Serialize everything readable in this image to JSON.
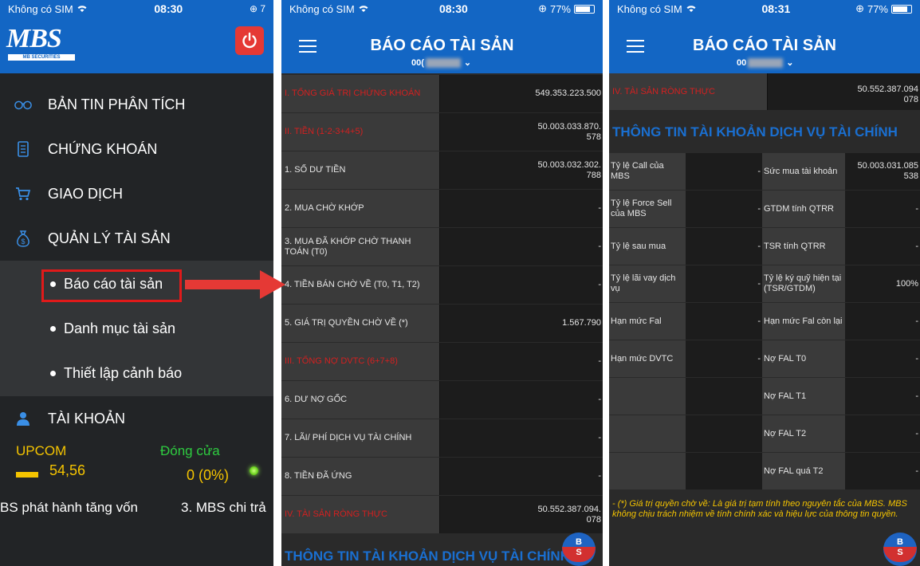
{
  "panel1": {
    "status": {
      "carrier": "Không có SIM",
      "time": "08:30"
    },
    "logo_text": "MBS",
    "logo_sub": "MB SECURITIES",
    "menu": [
      {
        "label": "BẢN TIN PHÂN TÍCH",
        "icon": "glasses-icon"
      },
      {
        "label": "CHỨNG KHOÁN",
        "icon": "document-icon"
      },
      {
        "label": "GIAO DỊCH",
        "icon": "cart-icon"
      },
      {
        "label": "QUẢN LÝ TÀI SẢN",
        "icon": "money-bag-icon"
      }
    ],
    "submenu": [
      "Báo cáo tài sản",
      "Danh mục tài sản",
      "Thiết lập cảnh báo"
    ],
    "account_label": "TÀI KHOẢN",
    "market": {
      "name": "UPCOM",
      "status": "Đóng cửa",
      "value": "54,56",
      "change": "0 (0%)"
    },
    "news": [
      "BS phát hành tăng vốn",
      "3. MBS chi trả"
    ]
  },
  "panel2": {
    "status": {
      "carrier": "Không có SIM",
      "time": "08:30",
      "battery": "77%"
    },
    "title": "BÁO CÁO TÀI SẢN",
    "account_prefix": "00(",
    "rows": [
      {
        "label": "I. TỔNG GIÁ TRỊ CHỨNG KHOÁN",
        "value": "549.353.223.500",
        "red": true
      },
      {
        "label": "II. TIỀN (1-2-3+4+5)",
        "value": "50.003.033.870.\n578",
        "red": true
      },
      {
        "label": "1. SỐ DƯ TIỀN",
        "value": "50.003.032.302.\n788",
        "red": false
      },
      {
        "label": "2. MUA CHỜ KHỚP",
        "value": "-",
        "red": false
      },
      {
        "label": "3. MUA ĐÃ KHỚP CHỜ THANH TOÁN (T0)",
        "value": "-",
        "red": false
      },
      {
        "label": "4. TIỀN BÁN CHỜ VỀ (T0, T1, T2)",
        "value": "-",
        "red": false
      },
      {
        "label": "5. GIÁ TRỊ QUYỀN CHỜ VỀ (*)",
        "value": "1.567.790",
        "red": false
      },
      {
        "label": "III. TỔNG NỢ DVTC (6+7+8)",
        "value": "-",
        "red": true
      },
      {
        "label": "6. DƯ NỢ GỐC",
        "value": "-",
        "red": false
      },
      {
        "label": "7. LÃI/ PHÍ DỊCH VỤ TÀI CHÍNH",
        "value": "-",
        "red": false
      },
      {
        "label": "8. TIỀN ĐÃ ỨNG",
        "value": "-",
        "red": false
      },
      {
        "label": "IV. TÀI SẢN RÒNG THỰC",
        "value": "50.552.387.094.\n078",
        "red": true
      }
    ],
    "section_title": "THÔNG TIN TÀI KHOẢN DỊCH VỤ TÀI CHÍNH",
    "bs": {
      "b": "B",
      "s": "S"
    }
  },
  "panel3": {
    "status": {
      "carrier": "Không có SIM",
      "time": "08:31",
      "battery": "77%"
    },
    "title": "BÁO CÁO TÀI SẢN",
    "account_prefix": "00",
    "top_row": {
      "label": "IV. TÀI SẢN RÒNG THỰC",
      "value": "50.552.387.094\n078"
    },
    "section_title": "THÔNG TIN TÀI KHOẢN DỊCH VỤ TÀI CHÍNH",
    "grid": [
      {
        "l1": "Tỷ lệ Call của MBS",
        "v1": "-",
        "l2": "Sức mua tài khoản",
        "v2": "50.003.031.085\n538"
      },
      {
        "l1": "Tỷ lệ Force Sell của MBS",
        "v1": "-",
        "l2": "GTDM tính QTRR",
        "v2": "-"
      },
      {
        "l1": "Tỷ lệ sau mua",
        "v1": "-",
        "l2": "TSR tính QTRR",
        "v2": "-"
      },
      {
        "l1": "Tỷ lệ lãi vay dịch vụ",
        "v1": "-",
        "l2": "Tỷ lệ ký quỹ hiện tại (TSR/GTDM)",
        "v2": "100%"
      },
      {
        "l1": "Hạn mức Fal",
        "v1": "-",
        "l2": "Hạn mức Fal còn lại",
        "v2": "-"
      },
      {
        "l1": "Hạn mức DVTC",
        "v1": "-",
        "l2": "Nợ FAL T0",
        "v2": "-"
      },
      {
        "l1": "",
        "v1": "",
        "l2": "Nợ FAL T1",
        "v2": "-"
      },
      {
        "l1": "",
        "v1": "",
        "l2": "Nợ FAL T2",
        "v2": "-"
      },
      {
        "l1": "",
        "v1": "",
        "l2": "Nợ FAL quá T2",
        "v2": "-"
      }
    ],
    "note": "- (*) Giá trị quyền chờ về: Là giá trị tạm tính theo nguyên tắc của MBS. MBS không chịu trách nhiệm về tính chính xác và hiệu lực của thông tin quyền.",
    "bs": {
      "b": "B",
      "s": "S"
    }
  },
  "colors": {
    "brand": "#1366c4",
    "highlight": "#e01a1a",
    "up": "#f5c400",
    "closed": "#2ecc40"
  }
}
